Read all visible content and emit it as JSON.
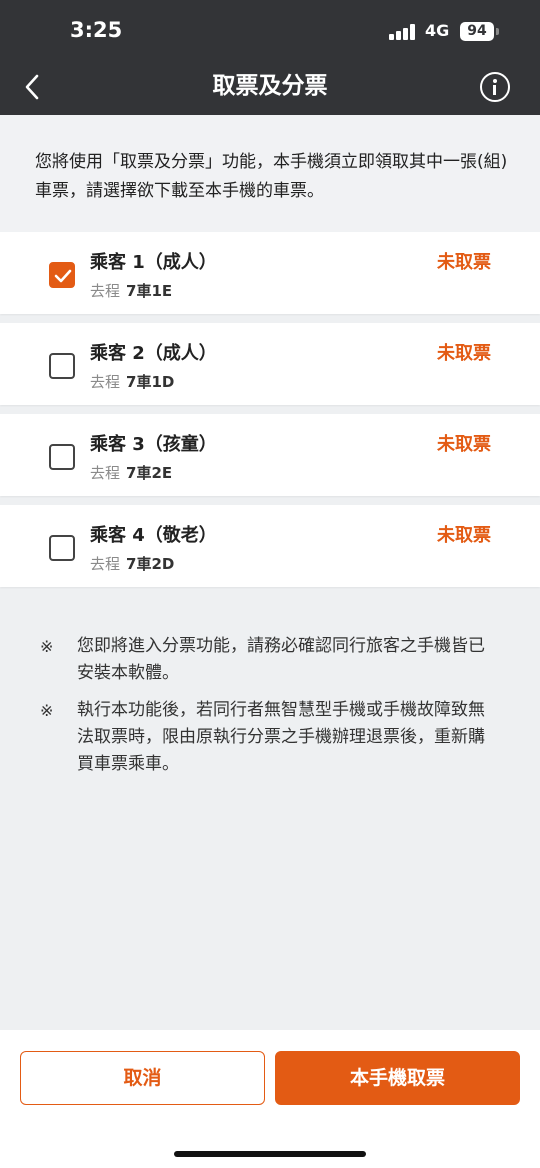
{
  "status_bar": {
    "time": "3:25",
    "network": "4G",
    "battery": "94"
  },
  "header": {
    "title": "取票及分票"
  },
  "intro": "您將使用「取票及分票」功能，本手機須立即領取其中一張(組)車票，請選擇欲下載至本手機的車票。",
  "passengers": [
    {
      "name": "乘客 1（成人）",
      "direction": "去程",
      "seat": "7車1E",
      "status": "未取票",
      "checked": true
    },
    {
      "name": "乘客 2（成人）",
      "direction": "去程",
      "seat": "7車1D",
      "status": "未取票",
      "checked": false
    },
    {
      "name": "乘客 3（孩童）",
      "direction": "去程",
      "seat": "7車2E",
      "status": "未取票",
      "checked": false
    },
    {
      "name": "乘客 4（敬老）",
      "direction": "去程",
      "seat": "7車2D",
      "status": "未取票",
      "checked": false
    }
  ],
  "notes": [
    {
      "mark": "※",
      "text": "您即將進入分票功能，請務必確認同行旅客之手機皆已安裝本軟體。"
    },
    {
      "mark": "※",
      "text": "執行本功能後，若同行者無智慧型手機或手機故障致無法取票時，限由原執行分票之手機辦理退票後，重新購買車票乘車。"
    }
  ],
  "footer": {
    "cancel_label": "取消",
    "confirm_label": "本手機取票"
  },
  "colors": {
    "accent": "#e35b14",
    "header_bg": "#333437"
  }
}
